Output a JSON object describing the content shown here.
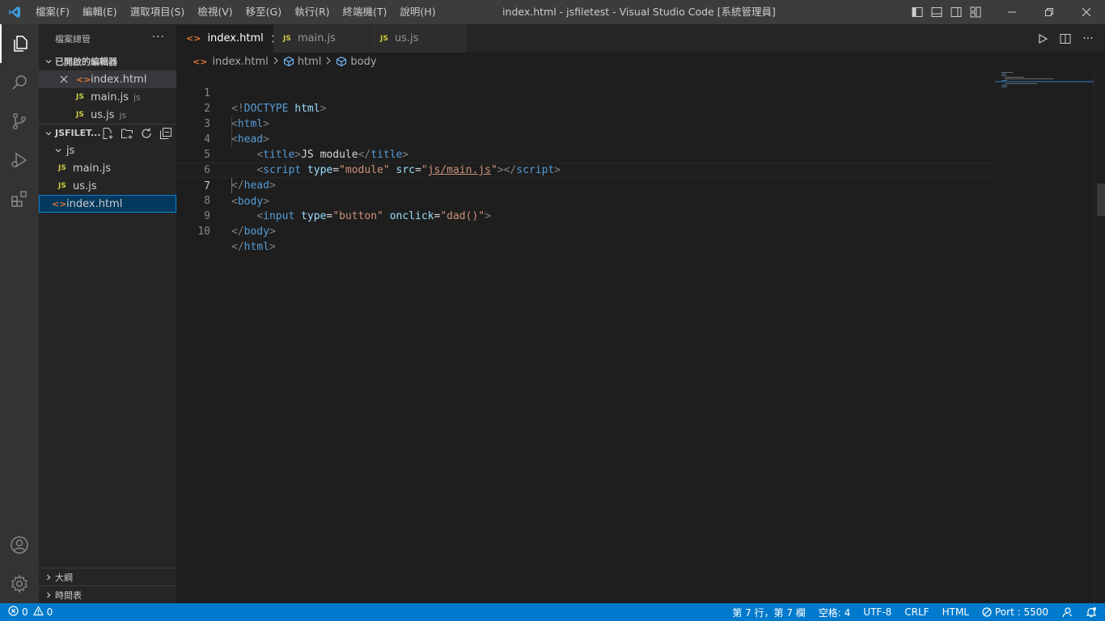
{
  "titlebar": {
    "menu": [
      "檔案(F)",
      "編輯(E)",
      "選取項目(S)",
      "檢視(V)",
      "移至(G)",
      "執行(R)",
      "終端機(T)",
      "說明(H)"
    ],
    "window_title": "index.html - jsfiletest - Visual Studio Code [系統管理員]"
  },
  "sidebar": {
    "title": "檔案總管",
    "more": "···",
    "open_editors": {
      "header": "已開啟的編輯器",
      "items": [
        {
          "icon": "<>",
          "name": "index.html",
          "desc": ""
        },
        {
          "icon": "JS",
          "name": "main.js",
          "desc": "js"
        },
        {
          "icon": "JS",
          "name": "us.js",
          "desc": "js"
        }
      ]
    },
    "folder": {
      "header": "JSFILET...",
      "tree": [
        {
          "icon": "",
          "name": "js"
        },
        {
          "icon": "JS",
          "name": "main.js"
        },
        {
          "icon": "JS",
          "name": "us.js"
        },
        {
          "icon": "<>",
          "name": "index.html"
        }
      ]
    },
    "outline": "大綱",
    "timeline": "時間表"
  },
  "tabs": [
    {
      "icon": "<>",
      "label": "index.html",
      "active": true
    },
    {
      "icon": "JS",
      "label": "main.js",
      "active": false
    },
    {
      "icon": "JS",
      "label": "us.js",
      "active": false
    }
  ],
  "breadcrumb": [
    "index.html",
    "html",
    "body"
  ],
  "code_lines": [
    "1",
    "2",
    "3",
    "4",
    "5",
    "6",
    "7",
    "8",
    "9",
    "10"
  ],
  "code": {
    "l1_a": "<!",
    "l1_b": "DOCTYPE",
    "l1_c": " html",
    "l1_d": ">",
    "l2_tag": "html",
    "l3_tag": "head",
    "l4_tag": "title",
    "l4_text": "JS module",
    "l5_tag": "script",
    "l5_attr1": " type",
    "l5_val1": "\"module\"",
    "l5_attr2": " src",
    "l5_val2a": "\"",
    "l5_val2b": "js/main.js",
    "l5_val2c": "\"",
    "l6_tag": "head",
    "l7_tag": "body",
    "l8_tag": "input",
    "l8_attr1": " type",
    "l8_val1": "\"button\"",
    "l8_attr2": " onclick",
    "l8_val2": "\"dad()\"",
    "l9_tag": "body",
    "l10_tag": "html"
  },
  "statusbar": {
    "errors": "0",
    "warnings": "0",
    "position": "第 7 行，第 7 欄",
    "spaces": "空格: 4",
    "encoding": "UTF-8",
    "eol": "CRLF",
    "language": "HTML",
    "port": "Port : 5500"
  },
  "colors": {
    "statusbar": "#007acc",
    "activitybar": "#333333",
    "sidebar": "#252526",
    "editor": "#1e1e1e",
    "titlebar": "#3c3c3c"
  }
}
